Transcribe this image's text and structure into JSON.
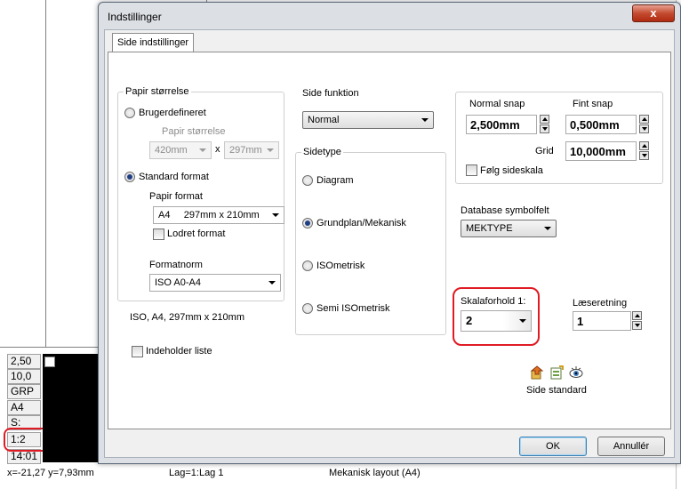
{
  "background": {
    "side_cells": [
      "2,50",
      "10,0",
      "GRP",
      "A4",
      "S:",
      "1:2",
      "14:01"
    ],
    "status": {
      "coords": "x=-21,27 y=7,93mm",
      "layer": "Lag=1:Lag 1",
      "layout": "Mekanisk layout (A4)"
    }
  },
  "dialog": {
    "title": "Indstillinger",
    "close_label": "x",
    "tab": "Side indstillinger",
    "paper_size": {
      "legend": "Papir størrelse",
      "custom_label": "Brugerdefineret",
      "custom_paper_size_label": "Papir størrelse",
      "width_value": "420mm",
      "x_sep": "x",
      "height_value": "297mm",
      "standard_label": "Standard format",
      "paper_format_label": "Papir format",
      "paper_format_value": "A4     297mm x 210mm",
      "portrait_label": "Lodret format",
      "format_norm_label": "Formatnorm",
      "format_norm_value": "ISO A0-A4",
      "summary": "ISO, A4, 297mm x 210mm"
    },
    "contains_list_label": "Indeholder liste",
    "page_function": {
      "legend": "Side funktion",
      "value": "Normal"
    },
    "page_type": {
      "legend": "Sidetype",
      "options": [
        "Diagram",
        "Grundplan/Mekanisk",
        "ISOmetrisk",
        "Semi ISOmetrisk"
      ],
      "selected_index": 1
    },
    "snap": {
      "normal_label": "Normal snap",
      "normal_value": "2,500mm",
      "fine_label": "Fint snap",
      "fine_value": "0,500mm",
      "grid_label": "Grid",
      "grid_value": "10,000mm",
      "follow_scale_label": "Følg sideskala"
    },
    "db_symbol": {
      "label": "Database symbolfelt",
      "value": "MEKTYPE"
    },
    "scale": {
      "label": "Skalaforhold 1:",
      "value": "2"
    },
    "reading_direction": {
      "label": "Læseretning",
      "value": "1"
    },
    "side_standard_label": "Side standard",
    "ok_label": "OK",
    "cancel_label": "Annullér",
    "colors": {
      "highlight": "#e01b24",
      "dialog_frame": "#dcdfe4"
    }
  }
}
